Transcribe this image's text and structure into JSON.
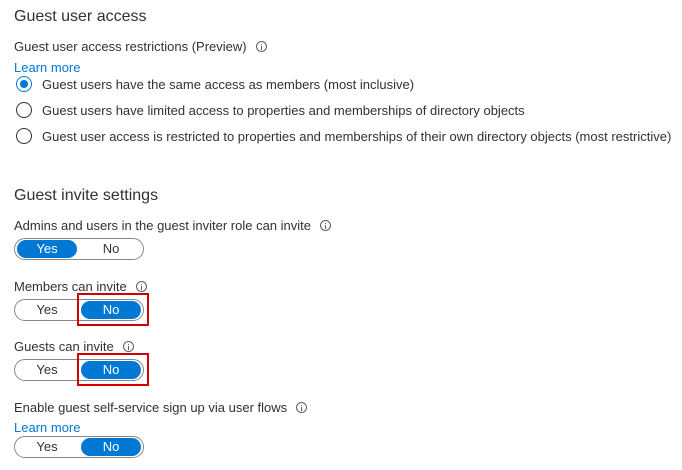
{
  "guest_user_access": {
    "title": "Guest user access",
    "restrictions_label": "Guest user access restrictions (Preview)",
    "learn_more": "Learn more",
    "options": [
      {
        "label": "Guest users have the same access as members (most inclusive)",
        "checked": true
      },
      {
        "label": "Guest users have limited access to properties and memberships of directory objects",
        "checked": false
      },
      {
        "label": "Guest user access is restricted to properties and memberships of their own directory objects (most restrictive)",
        "checked": false
      }
    ]
  },
  "guest_invite_settings": {
    "title": "Guest invite settings",
    "admins_invite": {
      "label": "Admins and users in the guest inviter role can invite",
      "yes": "Yes",
      "no": "No",
      "selected": "Yes"
    },
    "members_invite": {
      "label": "Members can invite",
      "yes": "Yes",
      "no": "No",
      "selected": "No"
    },
    "guests_invite": {
      "label": "Guests can invite",
      "yes": "Yes",
      "no": "No",
      "selected": "No"
    },
    "self_service": {
      "label": "Enable guest self-service sign up via user flows",
      "learn_more": "Learn more",
      "yes": "Yes",
      "no": "No",
      "selected": "No"
    }
  },
  "colors": {
    "accent": "#0078d4",
    "highlight": "#d00000"
  }
}
